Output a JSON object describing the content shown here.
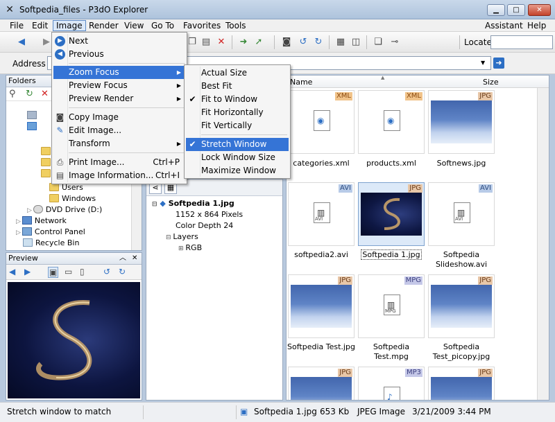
{
  "window": {
    "title": "Softpedia_files - P3dO Explorer"
  },
  "menubar": [
    "File",
    "Edit",
    "Image",
    "Render",
    "View",
    "Go To",
    "Favorites",
    "Tools",
    "Assistant",
    "Help"
  ],
  "toolbar": {
    "locate_label": "Locate"
  },
  "address": {
    "label": "Address"
  },
  "folders": {
    "title": "Folders",
    "items": [
      "Users",
      "Windows",
      "DVD Drive (D:)",
      "Network",
      "Control Panel",
      "Recycle Bin"
    ]
  },
  "preview": {
    "title": "Preview"
  },
  "properties": {
    "filename": "Softpedia 1.jpg",
    "resolution": "1152 x 864 Pixels",
    "color_depth": "Color Depth 24",
    "layers": "Layers",
    "rgb": "RGB"
  },
  "files": {
    "columns": [
      "Name",
      "Size"
    ],
    "items": [
      {
        "name": "categories.xml",
        "tag": "XML"
      },
      {
        "name": "products.xml",
        "tag": "XML"
      },
      {
        "name": "Softnews.jpg",
        "tag": "JPG"
      },
      {
        "name": "softpedia2.avi",
        "tag": "AVI"
      },
      {
        "name": "Softpedia 1.jpg",
        "tag": "JPG"
      },
      {
        "name": "Softpedia Slideshow.avi",
        "tag": "AVI"
      },
      {
        "name": "Softpedia Test.jpg",
        "tag": "JPG"
      },
      {
        "name": "Softpedia Test.mpg",
        "tag": "MPG"
      },
      {
        "name": "Softpedia Test_picopy.jpg",
        "tag": "JPG"
      },
      {
        "name": "",
        "tag": "JPG"
      },
      {
        "name": "",
        "tag": "MP3"
      },
      {
        "name": "",
        "tag": "JPG"
      }
    ]
  },
  "image_menu": {
    "items": [
      {
        "label": "Next",
        "icon": "next-icon"
      },
      {
        "label": "Previous",
        "icon": "previous-icon"
      },
      {
        "label": "Zoom Focus",
        "submenu": true
      },
      {
        "label": "Preview Focus",
        "submenu": true
      },
      {
        "label": "Preview Render",
        "submenu": true
      },
      {
        "label": "Copy Image",
        "icon": "camera-icon"
      },
      {
        "label": "Edit Image...",
        "icon": "edit-icon"
      },
      {
        "label": "Transform",
        "submenu": true
      },
      {
        "label": "Print Image...",
        "shortcut": "Ctrl+P",
        "icon": "printer-icon"
      },
      {
        "label": "Image Information...",
        "shortcut": "Ctrl+I",
        "icon": "info-icon"
      }
    ]
  },
  "zoom_menu": {
    "items": [
      {
        "label": "Actual Size",
        "checked": false
      },
      {
        "label": "Best Fit",
        "checked": false
      },
      {
        "label": "Fit to Window",
        "checked": true
      },
      {
        "label": "Fit Horizontally",
        "checked": false
      },
      {
        "label": "Fit Vertically",
        "checked": false
      },
      {
        "label": "Stretch Window",
        "checked": true
      },
      {
        "label": "Lock Window Size",
        "checked": false
      },
      {
        "label": "Maximize Window",
        "checked": false
      }
    ]
  },
  "status": {
    "hint": "Stretch window to match",
    "file": "Softpedia 1.jpg",
    "size": "653 Kb",
    "type": "JPEG Image",
    "date": "3/21/2009 3:44 PM"
  },
  "colors": {
    "highlight": "#3574d6",
    "selection": "#dce9f8"
  }
}
